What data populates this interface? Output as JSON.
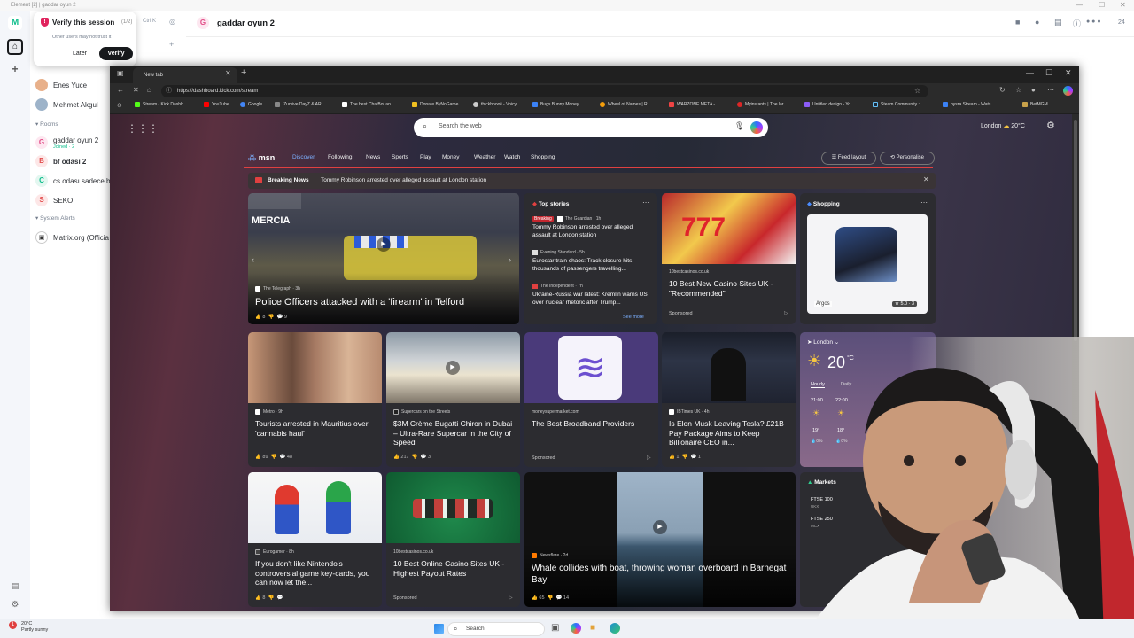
{
  "element_app": {
    "titlebar": "Element [2] | gaddar oyun 2",
    "verify_toast": {
      "title": "Verify this session",
      "counter": "(1/2)",
      "subtitle": "Other users may not trust it",
      "later": "Later",
      "verify": "Verify"
    },
    "shortcut": "Ctrl K",
    "people": [
      {
        "name": "Enes Yuce"
      },
      {
        "name": "Mehmet Akgul"
      }
    ],
    "rooms_header": "Rooms",
    "rooms": [
      {
        "name": "gaddar oyun 2",
        "sub": "Joined · 2",
        "letter": "G",
        "color": "#e24c87"
      },
      {
        "name": "bf odası 2",
        "letter": "B",
        "color": "#e24c4c"
      },
      {
        "name": "cs odası sadece b",
        "letter": "C",
        "color": "#0dbd8b"
      },
      {
        "name": "SEKO",
        "letter": "S",
        "color": "#e24c4c"
      }
    ],
    "system_header": "System Alerts",
    "system_room": "Matrix.org (Officia",
    "room_title": "gaddar oyun 2",
    "room_letter": "G",
    "header_count": "24"
  },
  "browser": {
    "tab_title": "New tab",
    "url": "https://dashboard.kick.com/stream",
    "bookmarks": [
      {
        "label": "Stream - Kick Dashb...",
        "color": "#53fc18"
      },
      {
        "label": "YouTube",
        "color": "#ff0000"
      },
      {
        "label": "Google",
        "color": "#4285f4"
      },
      {
        "label": "iZurvive DayZ & AR...",
        "color": "#888888"
      },
      {
        "label": "The best ChatBot an...",
        "color": "#ffffff"
      },
      {
        "label": "Donate ByNoGame",
        "color": "#f0c020"
      },
      {
        "label": "thickboooii - Voicy",
        "color": "#cccccc"
      },
      {
        "label": "Bugs Bunny Money...",
        "color": "#3b82f6"
      },
      {
        "label": "Wheel of Names | R...",
        "color": "#f59e0b"
      },
      {
        "label": "WARZONE META -...",
        "color": "#ef4444"
      },
      {
        "label": "Myinstants | The lar...",
        "color": "#dc2626"
      },
      {
        "label": "Untitled design - Yo...",
        "color": "#8b5cf6"
      },
      {
        "label": "Steam Community ::...",
        "color": "#1b2838"
      },
      {
        "label": "bysra Stream - Wats...",
        "color": "#3b82f6"
      },
      {
        "label": "BetMGM",
        "color": "#c8a14a"
      }
    ],
    "search_placeholder": "Search the web",
    "weather": {
      "city": "London",
      "temp": "20°C"
    },
    "msn": {
      "logo": "msn",
      "nav": [
        "Discover",
        "Following",
        "News",
        "Sports",
        "Play",
        "Money",
        "Weather",
        "Watch",
        "Shopping"
      ],
      "feed_layout": "Feed layout",
      "personalise": "Personalise",
      "breaking_label": "Breaking News",
      "breaking_headline": "Tommy Robinson arrested over alleged assault at London station",
      "hero": {
        "source": "The Telegraph · 3h",
        "title": "Police Officers attacked with a 'firearm' in Telford",
        "likes": "8",
        "comments": "9",
        "overlay": "MERCIA"
      },
      "top_stories": {
        "header": "Top stories",
        "breaking": "Breaking",
        "items": [
          {
            "source": "The Guardian · 1h",
            "headline": "Tommy Robinson arrested over alleged assault at London station"
          },
          {
            "source": "Evening Standard · 5h",
            "headline": "Eurostar train chaos: Track closure hits thousands of passengers travelling..."
          },
          {
            "source": "The Independent · 7h",
            "headline": "Ukraine-Russia war latest: Kremlin warns US over nuclear rhetoric after Trump..."
          }
        ],
        "see_more": "See more"
      },
      "casino_ad": {
        "source": "10bestcasinos.co.uk",
        "title": "10 Best New Casino Sites UK - \"Recommended\"",
        "sponsored": "Sponsored"
      },
      "shopping": {
        "header": "Shopping",
        "brand": "Argos",
        "rating": "★ 5.0 · 3"
      },
      "row2": [
        {
          "source": "Metro · 9h",
          "title": "Tourists arrested in Mauritius over 'cannabis haul'",
          "likes": "89",
          "comments": "48"
        },
        {
          "source": "Supercars on the Streets",
          "title": "$3M Crème Bugatti Chiron in Dubai – Ultra-Rare Supercar in the City of Speed",
          "likes": "217",
          "comments": "3"
        },
        {
          "source": "moneysupermarket.com",
          "title": "The Best Broadband Providers",
          "sponsored": "Sponsored"
        },
        {
          "source": "IBTimes UK · 4h",
          "title": "Is Elon Musk Leaving Tesla? £21B Pay Package Aims to Keep Billionaire CEO in...",
          "likes": "1",
          "comments": "1"
        }
      ],
      "weather_card": {
        "city": "London",
        "temp": "20",
        "unit": "°C",
        "tabs": [
          "Hourly",
          "Daily"
        ],
        "hours": [
          "21:00",
          "22:00"
        ],
        "temps": [
          "19°",
          "18°"
        ],
        "precip": [
          "0%",
          "0%"
        ]
      },
      "row3": [
        {
          "source": "Eurogamer · 8h",
          "title": "If you don't like Nintendo's controversial game key-cards, you can now let the...",
          "likes": "8"
        },
        {
          "source": "10bestcasinos.co.uk",
          "title": "10 Best Online Casino Sites UK - Highest Payout Rates",
          "sponsored": "Sponsored"
        },
        {
          "source": "Newsflare · 2d",
          "title": "Whale collides with boat, throwing woman overboard in Barnegat Bay",
          "likes": "65",
          "comments": "14"
        }
      ],
      "markets": {
        "header": "Markets",
        "items": [
          {
            "name": "FTSE 100",
            "sub": "UKX"
          },
          {
            "name": "FTSE 250",
            "sub": "MCX"
          }
        ]
      }
    }
  },
  "taskbar": {
    "weather_temp": "20°C",
    "weather_desc": "Partly sunny",
    "badge": "1",
    "search": "Search"
  }
}
